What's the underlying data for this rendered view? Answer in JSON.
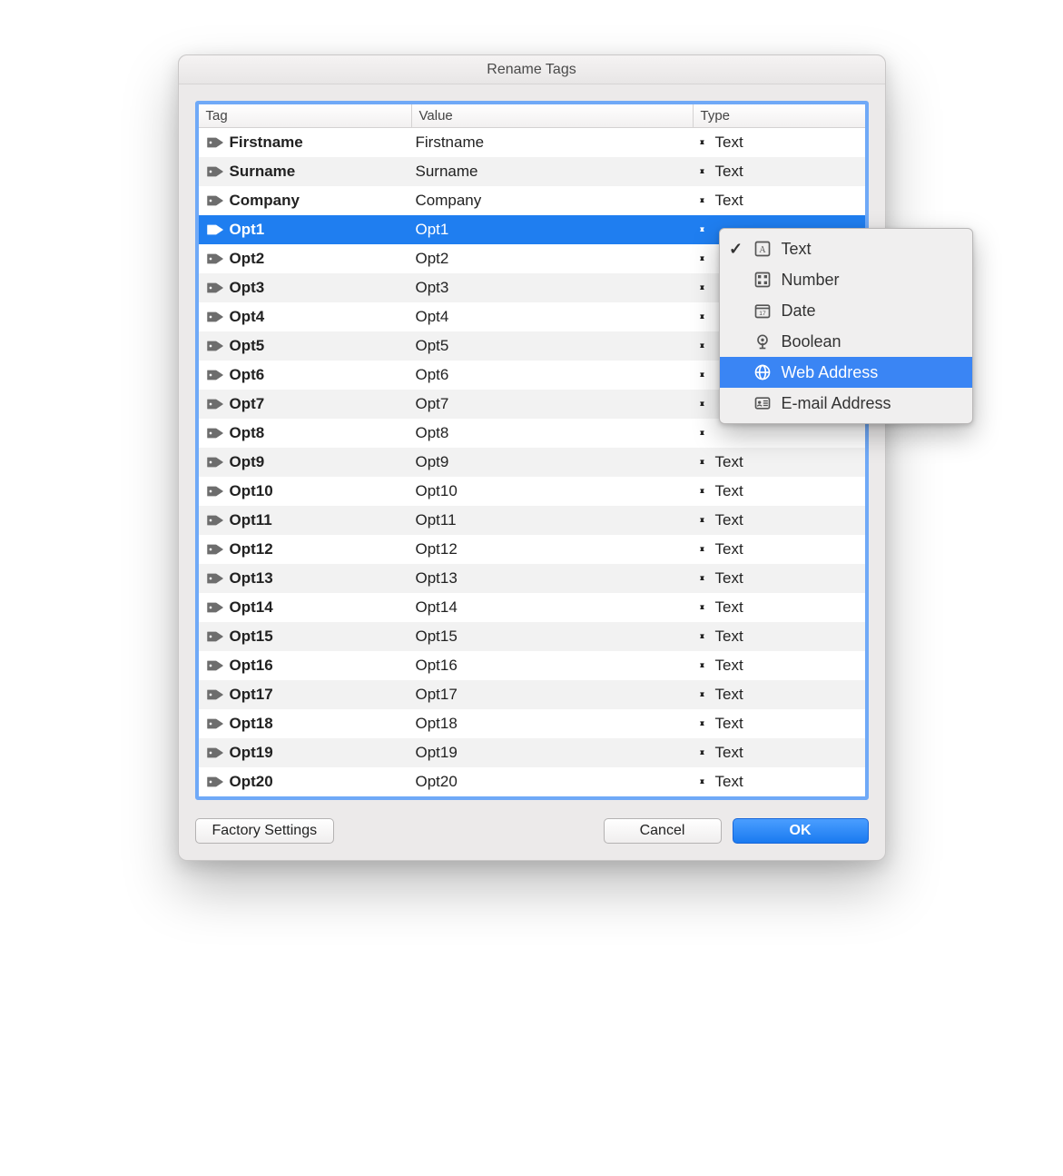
{
  "window": {
    "title": "Rename Tags"
  },
  "columns": {
    "tag": "Tag",
    "value": "Value",
    "type": "Type"
  },
  "rows": [
    {
      "tag": "Firstname",
      "value": "Firstname",
      "type": "Text",
      "selected": false
    },
    {
      "tag": "Surname",
      "value": "Surname",
      "type": "Text",
      "selected": false
    },
    {
      "tag": "Company",
      "value": "Company",
      "type": "Text",
      "selected": false
    },
    {
      "tag": "Opt1",
      "value": "Opt1",
      "type": "",
      "selected": true
    },
    {
      "tag": "Opt2",
      "value": "Opt2",
      "type": "",
      "selected": false
    },
    {
      "tag": "Opt3",
      "value": "Opt3",
      "type": "",
      "selected": false
    },
    {
      "tag": "Opt4",
      "value": "Opt4",
      "type": "",
      "selected": false
    },
    {
      "tag": "Opt5",
      "value": "Opt5",
      "type": "",
      "selected": false
    },
    {
      "tag": "Opt6",
      "value": "Opt6",
      "type": "",
      "selected": false
    },
    {
      "tag": "Opt7",
      "value": "Opt7",
      "type": "",
      "selected": false
    },
    {
      "tag": "Opt8",
      "value": "Opt8",
      "type": "",
      "selected": false
    },
    {
      "tag": "Opt9",
      "value": "Opt9",
      "type": "Text",
      "selected": false
    },
    {
      "tag": "Opt10",
      "value": "Opt10",
      "type": "Text",
      "selected": false
    },
    {
      "tag": "Opt11",
      "value": "Opt11",
      "type": "Text",
      "selected": false
    },
    {
      "tag": "Opt12",
      "value": "Opt12",
      "type": "Text",
      "selected": false
    },
    {
      "tag": "Opt13",
      "value": "Opt13",
      "type": "Text",
      "selected": false
    },
    {
      "tag": "Opt14",
      "value": "Opt14",
      "type": "Text",
      "selected": false
    },
    {
      "tag": "Opt15",
      "value": "Opt15",
      "type": "Text",
      "selected": false
    },
    {
      "tag": "Opt16",
      "value": "Opt16",
      "type": "Text",
      "selected": false
    },
    {
      "tag": "Opt17",
      "value": "Opt17",
      "type": "Text",
      "selected": false
    },
    {
      "tag": "Opt18",
      "value": "Opt18",
      "type": "Text",
      "selected": false
    },
    {
      "tag": "Opt19",
      "value": "Opt19",
      "type": "Text",
      "selected": false
    },
    {
      "tag": "Opt20",
      "value": "Opt20",
      "type": "Text",
      "selected": false
    }
  ],
  "buttons": {
    "factory": "Factory Settings",
    "cancel": "Cancel",
    "ok": "OK"
  },
  "popup": {
    "items": [
      {
        "label": "Text",
        "icon": "text",
        "checked": true,
        "highlighted": false
      },
      {
        "label": "Number",
        "icon": "number",
        "checked": false,
        "highlighted": false
      },
      {
        "label": "Date",
        "icon": "date",
        "checked": false,
        "highlighted": false
      },
      {
        "label": "Boolean",
        "icon": "boolean",
        "checked": false,
        "highlighted": false
      },
      {
        "label": "Web Address",
        "icon": "globe",
        "checked": false,
        "highlighted": true
      },
      {
        "label": "E-mail Address",
        "icon": "card",
        "checked": false,
        "highlighted": false
      }
    ]
  }
}
